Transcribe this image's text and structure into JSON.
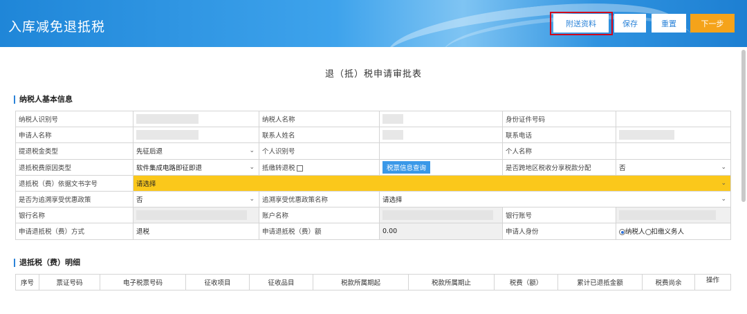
{
  "header": {
    "title": "入库减免退抵税",
    "buttons": {
      "attach": "附送资料",
      "save": "保存",
      "reset": "重置",
      "next": "下一步"
    }
  },
  "form_title": "退（抵）税申请审批表",
  "section1": {
    "title": "纳税人基本信息",
    "rows": [
      {
        "l1": "纳税人识别号",
        "v1": "",
        "l2": "纳税人名称",
        "v2": "",
        "l3": "身份证件号码",
        "v3": ""
      },
      {
        "l1": "申请人名称",
        "v1": "",
        "l2": "联系人姓名",
        "v2": "",
        "l3": "联系电话",
        "v3": ""
      },
      {
        "l1": "提退税金类型",
        "v1": "先征后退",
        "l2": "个人识别号",
        "v2": "",
        "l3": "个人名称",
        "v3": ""
      },
      {
        "l1": "退抵税费原因类型",
        "v1": "软件集成电路即征即退",
        "l2": "抵缴转退税",
        "v2": "税票信息查询",
        "l3": "是否跨地区税收分享税款分配",
        "v3": "否"
      },
      {
        "l1": "退抵税（费）依据文书字号",
        "v1": "请选择"
      },
      {
        "l1": "是否为追溯享受优惠政策",
        "v1": "否",
        "l2": "追溯享受优惠政策名称",
        "v2": "请选择"
      },
      {
        "l1": "银行名称",
        "v1": "",
        "l2": "账户名称",
        "v2": "",
        "l3": "银行账号",
        "v3": ""
      },
      {
        "l1": "申请退抵税（费）方式",
        "v1": "退税",
        "l2": "申请退抵税（费）额",
        "v2": "0.00",
        "l3": "申请人身份",
        "r1": "纳税人",
        "r2": "扣缴义务人"
      }
    ]
  },
  "section2": {
    "title": "退抵税（费）明细",
    "columns": [
      "序号",
      "票证号码",
      "电子税票号码",
      "征收项目",
      "征收品目",
      "税款所属期起",
      "税款所属期止",
      "税费（额）",
      "累计已退抵金额",
      "税费尚余",
      "操作"
    ]
  },
  "colors": {
    "accent": "#2b83d8",
    "next_button": "#f5a31a",
    "highlight_row": "#fbc81b",
    "attach_outline": "#d0021b"
  }
}
